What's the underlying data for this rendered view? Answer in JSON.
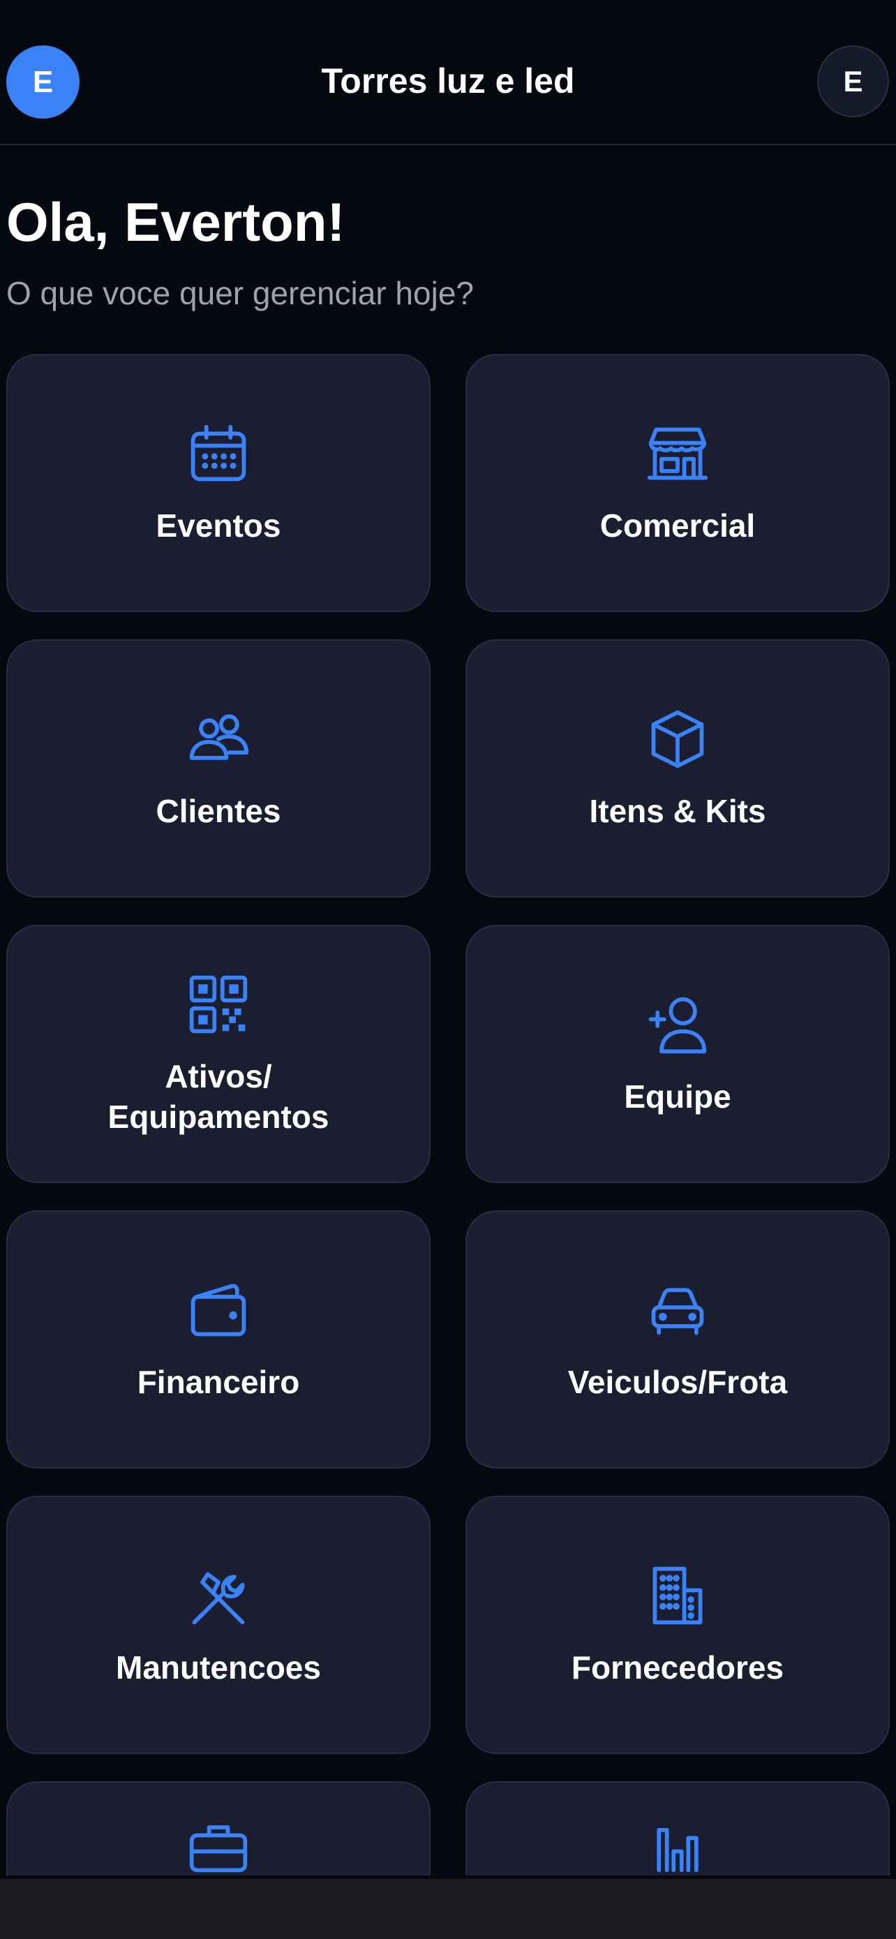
{
  "header": {
    "avatar_left": "E",
    "title": "Torres luz e led",
    "avatar_right": "E"
  },
  "greeting": "Ola, Everton!",
  "subtitle": "O que voce quer gerenciar hoje?",
  "colors": {
    "background": "#05080f",
    "card": "#1b1d30",
    "accent": "#3b82f6",
    "muted_text": "#9ca3af"
  },
  "cards": [
    {
      "label": "Eventos",
      "icon": "calendar-icon"
    },
    {
      "label": "Comercial",
      "icon": "storefront-icon"
    },
    {
      "label": "Clientes",
      "icon": "users-icon"
    },
    {
      "label": "Itens & Kits",
      "icon": "cube-icon"
    },
    {
      "label": "Ativos/ Equipamentos",
      "icon": "qr-code-icon"
    },
    {
      "label": "Equipe",
      "icon": "user-plus-icon"
    },
    {
      "label": "Financeiro",
      "icon": "wallet-icon"
    },
    {
      "label": "Veiculos/Frota",
      "icon": "car-icon"
    },
    {
      "label": "Manutencoes",
      "icon": "wrench-hammer-icon"
    },
    {
      "label": "Fornecedores",
      "icon": "building-icon"
    },
    {
      "label": "",
      "icon": "briefcase-icon"
    },
    {
      "label": "",
      "icon": "bar-chart-icon"
    }
  ]
}
